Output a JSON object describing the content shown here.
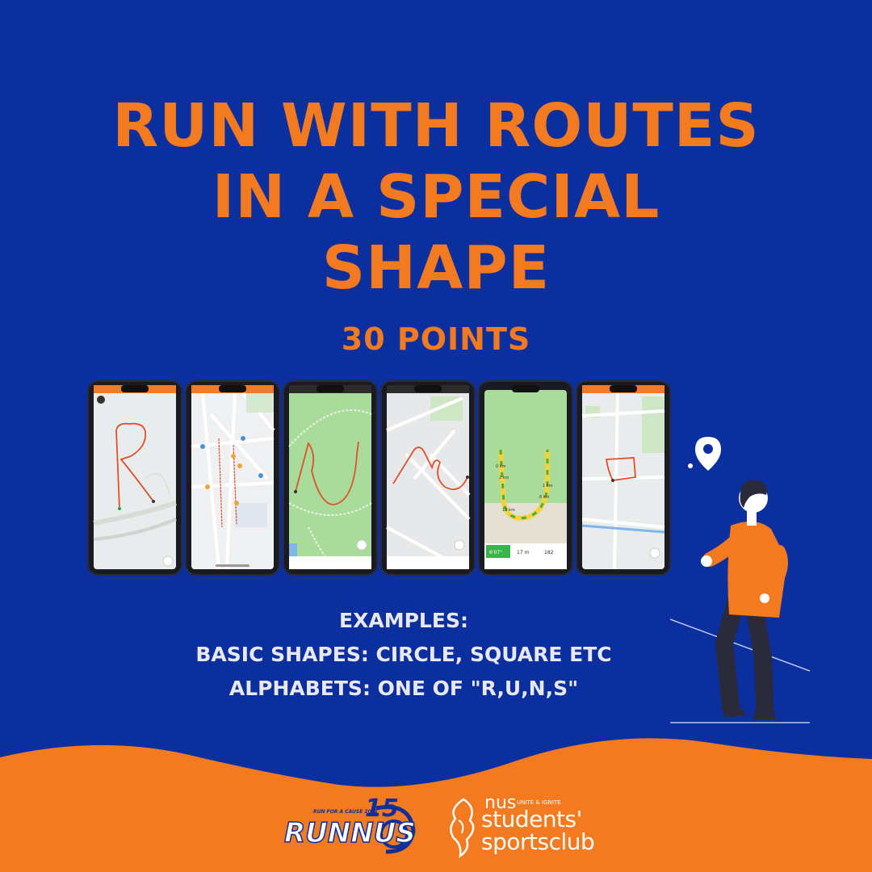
{
  "title": {
    "line1": "RUN WITH ROUTES",
    "line2": "IN A SPECIAL",
    "line3": "SHAPE"
  },
  "points": "30 POINTS",
  "examples": {
    "heading": "EXAMPLES:",
    "line1": "BASIC SHAPES: CIRCLE, SQUARE ETC",
    "line2": "ALPHABETS: ONE OF \"R,U,N,S\""
  },
  "phones": [
    {
      "shape": "letter-r-route",
      "map": "grey-map"
    },
    {
      "shape": "street-map-pins",
      "map": "street-map"
    },
    {
      "shape": "letter-u-route",
      "map": "green-park-map"
    },
    {
      "shape": "letter-n-route",
      "map": "grey-map"
    },
    {
      "shape": "letter-u-track",
      "map": "green-park-map",
      "readouts": [
        "0 km",
        "2 km",
        "1 km",
        "6 km",
        "13 km",
        "6'07\"",
        "17 m",
        "182"
      ]
    },
    {
      "shape": "square-route",
      "map": "street-map"
    }
  ],
  "logos": {
    "runnus_tagline": "RUN FOR A CAUSE 2021",
    "runnus_text": "RUNNUS",
    "ssc_nus": "nus",
    "ssc_tagline": "UNITE & IGNITE",
    "ssc_line1": "students'",
    "ssc_line2": "sportsclub"
  },
  "colors": {
    "background": "#0b2f9f",
    "accent": "#f47a20",
    "text_light": "#e8e8f0"
  }
}
